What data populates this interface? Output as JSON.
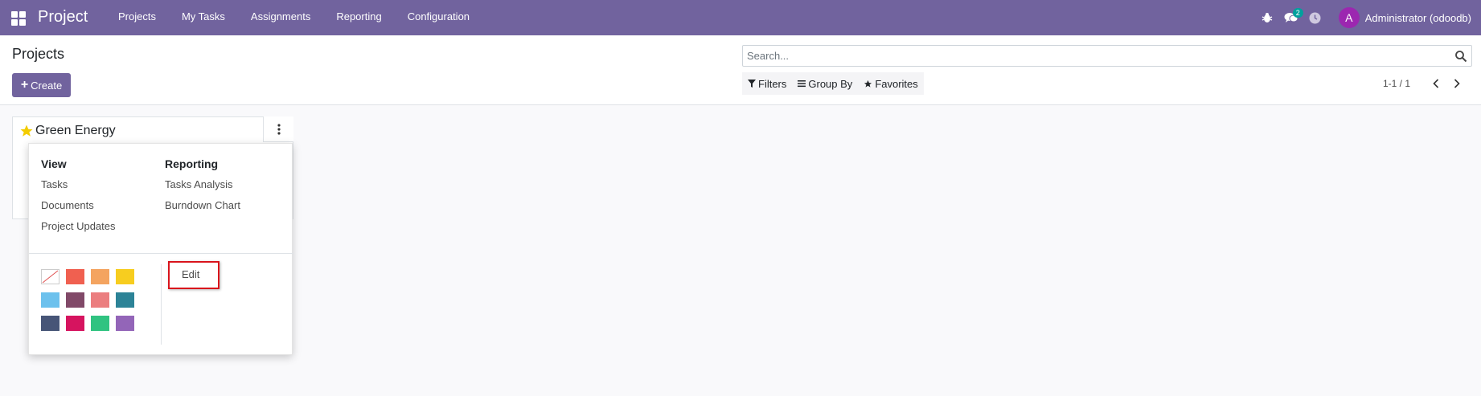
{
  "navbar": {
    "brand": "Project",
    "menu": [
      "Projects",
      "My Tasks",
      "Assignments",
      "Reporting",
      "Configuration"
    ],
    "messages_badge": "2",
    "user_initial": "A",
    "user_name": "Administrator (odoodb)",
    "colors": {
      "background": "#71639e",
      "avatar": "#9c27b0",
      "badge": "#00a09d"
    },
    "icons": [
      "apps-grid-icon",
      "bug-icon",
      "chat-icon",
      "clock-icon"
    ]
  },
  "control_panel": {
    "title": "Projects",
    "create_label": "Create",
    "search_placeholder": "Search...",
    "filters_label": "Filters",
    "group_by_label": "Group By",
    "favorites_label": "Favorites",
    "pager": "1-1 / 1"
  },
  "card": {
    "title": "Green Energy",
    "favorite": true
  },
  "dropdown": {
    "view_heading": "View",
    "view_links": [
      "Tasks",
      "Documents",
      "Project Updates"
    ],
    "reporting_heading": "Reporting",
    "reporting_links": [
      "Tasks Analysis",
      "Burndown Chart"
    ],
    "edit_label": "Edit",
    "swatch_colors": [
      "none",
      "#f06050",
      "#f4a460",
      "#f7cd1f",
      "#6cc1ed",
      "#814968",
      "#eb7e7f",
      "#2c8397",
      "#475577",
      "#d6145f",
      "#30c381",
      "#9365b8"
    ]
  }
}
